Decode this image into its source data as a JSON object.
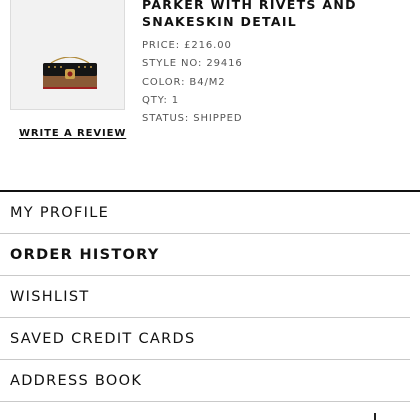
{
  "order_item": {
    "name": "PARKER WITH RIVETS AND SNAKESKIN DETAIL",
    "image_icon": "handbag-image",
    "price": "PRICE: £216.00",
    "style_no": "STYLE NO: 29416",
    "color": "COLOR: B4/M2",
    "qty": "QTY: 1",
    "status": "STATUS: SHIPPED",
    "write_review": "WRITE A REVIEW"
  },
  "account_menu": {
    "items": [
      {
        "label": "MY PROFILE",
        "active": false
      },
      {
        "label": "ORDER HISTORY",
        "active": true
      },
      {
        "label": "WISHLIST",
        "active": false
      },
      {
        "label": "SAVED CREDIT CARDS",
        "active": false
      },
      {
        "label": "ADDRESS BOOK",
        "active": false
      }
    ]
  },
  "colors": {
    "text": "#111111",
    "meta_text": "#555555",
    "thumb_bg": "#f2f2f2",
    "divider": "#c9c9c9"
  }
}
